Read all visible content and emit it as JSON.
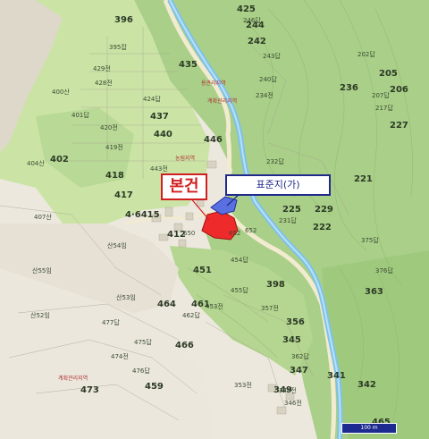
{
  "labels": {
    "subject": "본건",
    "reference": "표준지(가)",
    "scale": "100 m"
  },
  "colors": {
    "forest": "#a7cf86",
    "forest_dark": "#8fbf6c",
    "field": "#cfe6a9",
    "bare": "#e8e3d6",
    "river": "#86c8ee",
    "subject_fill": "#ee2a2a",
    "reference_fill": "#5a6fe0"
  },
  "zones": [
    "용관리지역",
    "계획관리지역",
    "농림지역",
    "계획관리지역"
  ],
  "parcels": [
    {
      "no": "396",
      "big": true
    },
    {
      "no": "425",
      "big": true
    },
    {
      "no": "244",
      "big": true
    },
    {
      "no": "435",
      "big": true
    },
    {
      "no": "242",
      "big": true
    },
    {
      "no": "205",
      "big": true
    },
    {
      "no": "236",
      "big": true
    },
    {
      "no": "206",
      "big": true
    },
    {
      "no": "437",
      "big": true
    },
    {
      "no": "440",
      "big": true
    },
    {
      "no": "446",
      "big": true
    },
    {
      "no": "402",
      "big": true
    },
    {
      "no": "418",
      "big": true
    },
    {
      "no": "417",
      "big": true
    },
    {
      "no": "451",
      "big": true
    },
    {
      "no": "398",
      "big": true
    },
    {
      "no": "356",
      "big": true
    },
    {
      "no": "363",
      "big": true
    },
    {
      "no": "464",
      "big": true
    },
    {
      "no": "466",
      "big": true
    },
    {
      "no": "473",
      "big": true
    },
    {
      "no": "342",
      "big": true
    },
    {
      "no": "341",
      "big": true
    },
    {
      "no": "345",
      "big": true
    },
    {
      "no": "221",
      "big": true
    },
    {
      "no": "229",
      "big": true
    },
    {
      "no": "225",
      "big": true
    },
    {
      "no": "227",
      "big": true
    },
    {
      "no": "222",
      "big": true
    },
    {
      "no": "459",
      "big": true
    },
    {
      "no": "4·6415",
      "big": true
    },
    {
      "no": "412",
      "big": true
    },
    {
      "no": "461",
      "big": true
    },
    {
      "no": "347",
      "big": true
    },
    {
      "no": "349",
      "big": true
    },
    {
      "no": "465",
      "big": true
    },
    {
      "no": "395잡",
      "big": false
    },
    {
      "no": "429전",
      "big": false
    },
    {
      "no": "428전",
      "big": false
    },
    {
      "no": "424답",
      "big": false
    },
    {
      "no": "400산",
      "big": false
    },
    {
      "no": "401답",
      "big": false
    },
    {
      "no": "420전",
      "big": false
    },
    {
      "no": "419전",
      "big": false
    },
    {
      "no": "404산",
      "big": false
    },
    {
      "no": "443전",
      "big": false
    },
    {
      "no": "407산",
      "big": false
    },
    {
      "no": "산54임",
      "big": false
    },
    {
      "no": "산55임",
      "big": false
    },
    {
      "no": "산53임",
      "big": false
    },
    {
      "no": "산52임",
      "big": false
    },
    {
      "no": "454답",
      "big": false
    },
    {
      "no": "455답",
      "big": false
    },
    {
      "no": "453전",
      "big": false
    },
    {
      "no": "462답",
      "big": false
    },
    {
      "no": "357전",
      "big": false
    },
    {
      "no": "375답",
      "big": false
    },
    {
      "no": "376답",
      "big": false
    },
    {
      "no": "234전",
      "big": false
    },
    {
      "no": "231답",
      "big": false
    },
    {
      "no": "232답",
      "big": false
    },
    {
      "no": "240답",
      "big": false
    },
    {
      "no": "246답",
      "big": false
    },
    {
      "no": "243답",
      "big": false
    },
    {
      "no": "217답",
      "big": false
    },
    {
      "no": "202답",
      "big": false
    },
    {
      "no": "207답",
      "big": false
    },
    {
      "no": "652",
      "big": false
    },
    {
      "no": "650",
      "big": false
    },
    {
      "no": "652",
      "big": false
    },
    {
      "no": "474전",
      "big": false
    },
    {
      "no": "475답",
      "big": false
    },
    {
      "no": "476답",
      "big": false
    },
    {
      "no": "477답",
      "big": false
    },
    {
      "no": "348전",
      "big": false
    },
    {
      "no": "346전",
      "big": false
    },
    {
      "no": "353전",
      "big": false
    },
    {
      "no": "362답",
      "big": false
    }
  ]
}
